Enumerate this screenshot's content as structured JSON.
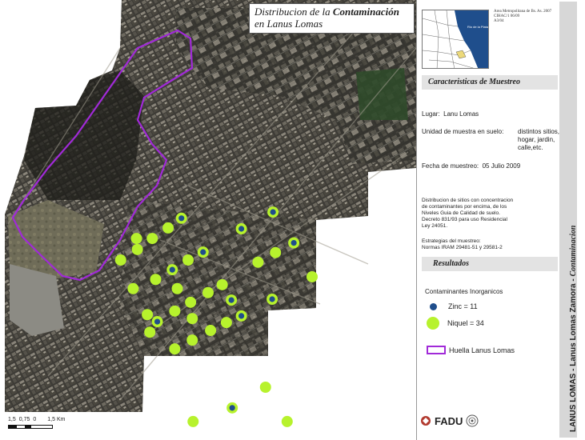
{
  "map": {
    "title_part1": "Distribucion de la ",
    "title_bold": "Contaminación",
    "title_line2": "en Lanus Lomas",
    "scale_labels": [
      "1,5",
      "0,75",
      "0",
      "1,5 Km"
    ],
    "colors": {
      "niquel": "#b7f22d",
      "zinc": "#1f4e8c",
      "boundary": "#a12ad8"
    },
    "points": [
      {
        "type": "zinc",
        "x": 0.436,
        "y": 0.496
      },
      {
        "type": "niquel",
        "x": 0.404,
        "y": 0.518
      },
      {
        "type": "niquel",
        "x": 0.366,
        "y": 0.542
      },
      {
        "type": "niquel",
        "x": 0.328,
        "y": 0.542
      },
      {
        "type": "zinc",
        "x": 0.58,
        "y": 0.52
      },
      {
        "type": "zinc",
        "x": 0.656,
        "y": 0.482
      },
      {
        "type": "zinc",
        "x": 0.706,
        "y": 0.552
      },
      {
        "type": "niquel",
        "x": 0.662,
        "y": 0.574
      },
      {
        "type": "niquel",
        "x": 0.62,
        "y": 0.596
      },
      {
        "type": "zinc",
        "x": 0.488,
        "y": 0.573
      },
      {
        "type": "niquel",
        "x": 0.452,
        "y": 0.591
      },
      {
        "type": "niquel",
        "x": 0.29,
        "y": 0.591
      },
      {
        "type": "niquel",
        "x": 0.33,
        "y": 0.567
      },
      {
        "type": "zinc",
        "x": 0.414,
        "y": 0.613
      },
      {
        "type": "niquel",
        "x": 0.374,
        "y": 0.635
      },
      {
        "type": "niquel",
        "x": 0.32,
        "y": 0.656
      },
      {
        "type": "niquel",
        "x": 0.426,
        "y": 0.656
      },
      {
        "type": "niquel",
        "x": 0.534,
        "y": 0.647
      },
      {
        "type": "niquel",
        "x": 0.75,
        "y": 0.629
      },
      {
        "type": "niquel",
        "x": 0.5,
        "y": 0.665
      },
      {
        "type": "niquel",
        "x": 0.458,
        "y": 0.687
      },
      {
        "type": "zinc",
        "x": 0.556,
        "y": 0.682
      },
      {
        "type": "zinc",
        "x": 0.654,
        "y": 0.68
      },
      {
        "type": "niquel",
        "x": 0.42,
        "y": 0.707
      },
      {
        "type": "niquel",
        "x": 0.462,
        "y": 0.724
      },
      {
        "type": "niquel",
        "x": 0.354,
        "y": 0.715
      },
      {
        "type": "zinc",
        "x": 0.58,
        "y": 0.718
      },
      {
        "type": "niquel",
        "x": 0.544,
        "y": 0.733
      },
      {
        "type": "zinc",
        "x": 0.378,
        "y": 0.731
      },
      {
        "type": "niquel",
        "x": 0.36,
        "y": 0.755
      },
      {
        "type": "niquel",
        "x": 0.506,
        "y": 0.751
      },
      {
        "type": "niquel",
        "x": 0.462,
        "y": 0.773
      },
      {
        "type": "niquel",
        "x": 0.42,
        "y": 0.793
      },
      {
        "type": "niquel",
        "x": 0.638,
        "y": 0.88
      },
      {
        "type": "zinc",
        "x": 0.558,
        "y": 0.927
      },
      {
        "type": "niquel",
        "x": 0.464,
        "y": 0.958
      },
      {
        "type": "niquel",
        "x": 0.69,
        "y": 0.958
      }
    ]
  },
  "inset": {
    "river_label": "Rio de la Plata",
    "caption_line1": "Area Metropolitana de Bs. As. 2007",
    "caption_line2": "CIHAC/1 06/09",
    "caption_line3": "A3/04"
  },
  "panel": {
    "section_caracteristicas": "Caracteristicas de Muestreo",
    "lugar_label": "Lugar:",
    "lugar_value": "Lanu Lomas",
    "unidad_label": "Unidad de muestra en suelo:",
    "unidad_value_1": "distintos sitios,",
    "unidad_value_2": "hogar, jardin,",
    "unidad_value_3": "calle,etc.",
    "fecha_label": "Fecha de muestreo:",
    "fecha_value": "05 Julio 2009",
    "dist_text_1": "Distribucion de sitios con concentracion",
    "dist_text_2": "de contaminantes por encima, de los",
    "dist_text_3": "Niveles Guia de Calidad de suelo.",
    "dist_text_4": "Decreto 831/93 para uso Residencial",
    "dist_text_5": "Ley 24051.",
    "estrategias_1": "Estrategias del muestreo:",
    "estrategias_2": "Normas IRAM 29481-51 y 29581-2",
    "section_resultados": "Resultados",
    "contaminantes_title": "Contaminantes Inorganicos",
    "zinc_label": "Zinc = 11",
    "niquel_label": "Niquel = 34",
    "huella_label": "Huella Lanus Lomas",
    "fadu_label": "FADU",
    "vertical_title_plain": "LANUS LOMAS - Lanus Lomas Zamora - ",
    "vertical_title_italic": "Contaminacion"
  }
}
